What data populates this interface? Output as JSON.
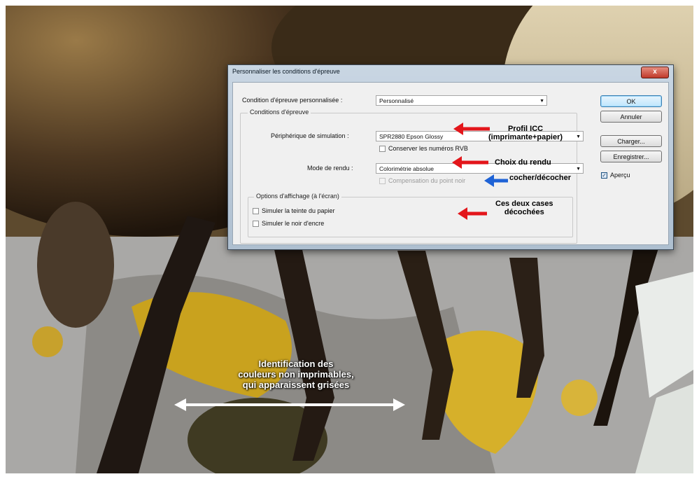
{
  "dialog": {
    "title": "Personnaliser les conditions d'épreuve",
    "close_label": "x",
    "custom_condition_label": "Condition d'épreuve personnalisée :",
    "custom_condition_value": "Personnalisé",
    "group_title": "Conditions d'épreuve",
    "device_label": "Périphérique de simulation :",
    "device_value": "SPR2880 Epson Glossy",
    "preserve_rgb_label": "Conserver les numéros RVB",
    "preserve_rgb_checked": false,
    "rendering_label": "Mode de rendu :",
    "rendering_value": "Colorimétrie absolue",
    "black_point_label": "Compensation du point noir",
    "black_point_checked": false,
    "black_point_enabled": false,
    "display_group_title": "Options d'affichage (à l'écran)",
    "paper_label": "Simuler la teinte du papier",
    "paper_checked": false,
    "ink_label": "Simuler le noir d'encre",
    "ink_checked": false,
    "buttons": {
      "ok": "OK",
      "cancel": "Annuler",
      "load": "Charger...",
      "save": "Enregistrer..."
    },
    "preview_label": "Aperçu",
    "preview_checked": true
  },
  "annotations": {
    "profile_line1": "Profil ICC",
    "profile_line2": "(imprimante+papier)",
    "rendering_choice": "Choix du rendu",
    "check_uncheck": "cocher/décocher",
    "two_boxes_line1": "Ces deux cases",
    "two_boxes_line2": "décochées",
    "gray_line1": "Identification des",
    "gray_line2": "couleurs non imprimables,",
    "gray_line3": "qui apparaissent grisées"
  },
  "colors": {
    "red_arrow": "#e3161b",
    "blue_arrow": "#1f63d6",
    "white_arrow": "#ffffff"
  }
}
